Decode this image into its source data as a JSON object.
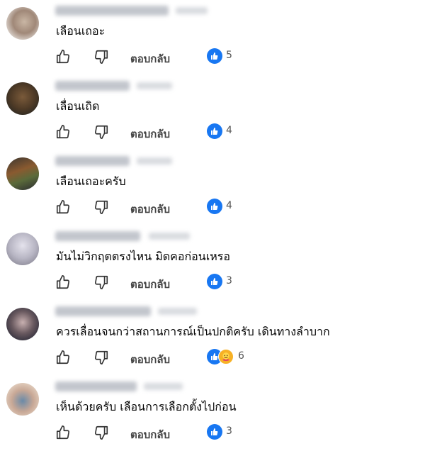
{
  "comments": [
    {
      "text": "เลือนเถอะ",
      "reply_label": "ตอบกลับ",
      "like_count": "5",
      "reactions": [
        "like"
      ]
    },
    {
      "text": "เลื่อนเถิด",
      "reply_label": "ตอบกลับ",
      "like_count": "4",
      "reactions": [
        "like"
      ]
    },
    {
      "text": "เลือนเถอะครับ",
      "reply_label": "ตอบกลับ",
      "like_count": "4",
      "reactions": [
        "like"
      ]
    },
    {
      "text": "มันไม่วิกฤตตรงไหน มิดคอก่อนเหรอ",
      "reply_label": "ตอบกลับ",
      "like_count": "3",
      "reactions": [
        "like"
      ]
    },
    {
      "text": "ควรเลื่อนจนกว่าสถานการณ์เป็นปกติครับ เดินทางลำบาก",
      "reply_label": "ตอบกลับ",
      "like_count": "6",
      "reactions": [
        "like",
        "hug"
      ]
    },
    {
      "text": "เห็นด้วยครับ เลือนการเลือกตั้งไปก่อน",
      "reply_label": "ตอบกลับ",
      "like_count": "3",
      "reactions": [
        "like"
      ]
    }
  ],
  "icons": {
    "like": "thumbs-up-icon",
    "dislike": "thumbs-down-icon",
    "reaction": "like-reaction-icon",
    "hug": "hug-reaction-icon"
  },
  "colors": {
    "accent": "#1877f2",
    "text": "#050505",
    "muted": "#444444"
  }
}
